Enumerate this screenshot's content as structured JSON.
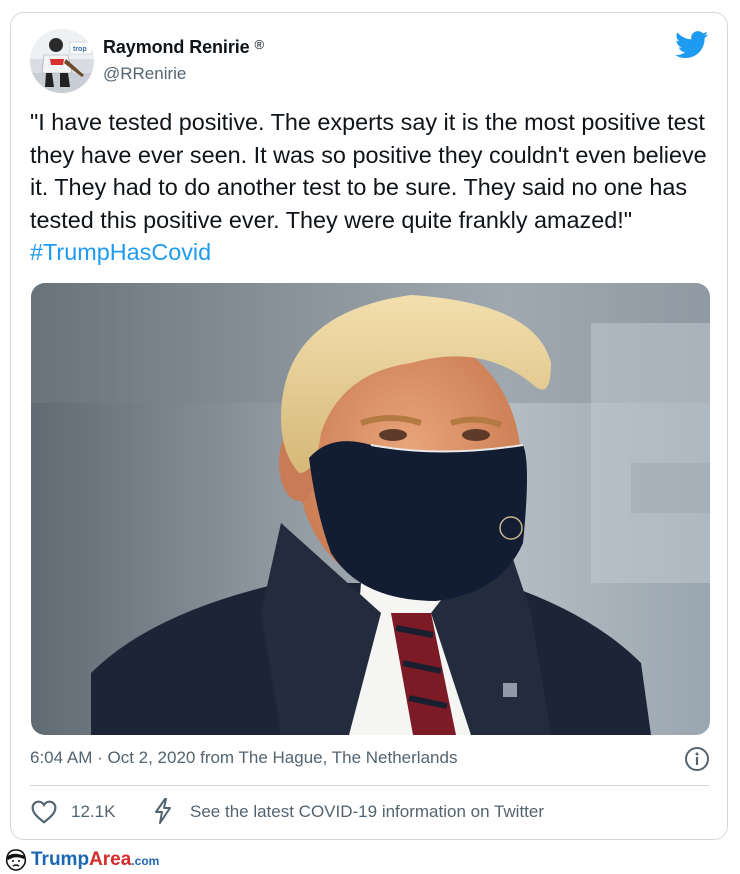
{
  "tweet": {
    "author_name": "Raymond Renirie",
    "registered_mark": "®",
    "handle": "@RRenirie",
    "text": "\"I have tested positive. The experts say it is the most positive test they have ever seen. It was so positive they couldn't even believe it. They had to do another test to be sure. They said no one has tested this positive ever. They were quite frankly amazed!\"",
    "hashtag": "#TrumpHasCovid",
    "timestamp": "6:04 AM · Oct 2, 2020 from The Hague, The Netherlands",
    "like_count": "12.1K",
    "covid_link": "See the latest COVID-19 information on Twitter"
  },
  "avatar_badge": "trop",
  "footer": {
    "brand_part1": "Trump",
    "brand_part2": "Area",
    "domain": ".com"
  },
  "colors": {
    "link": "#1d9bf0",
    "muted": "#536471",
    "border": "#cfd9de",
    "brand_blue": "#1b67b3",
    "brand_red": "#d62b2b"
  },
  "icons": [
    "avatar",
    "twitter-bird-icon",
    "info-icon",
    "heart-icon",
    "lightning-icon",
    "trumparea-logo-icon"
  ]
}
